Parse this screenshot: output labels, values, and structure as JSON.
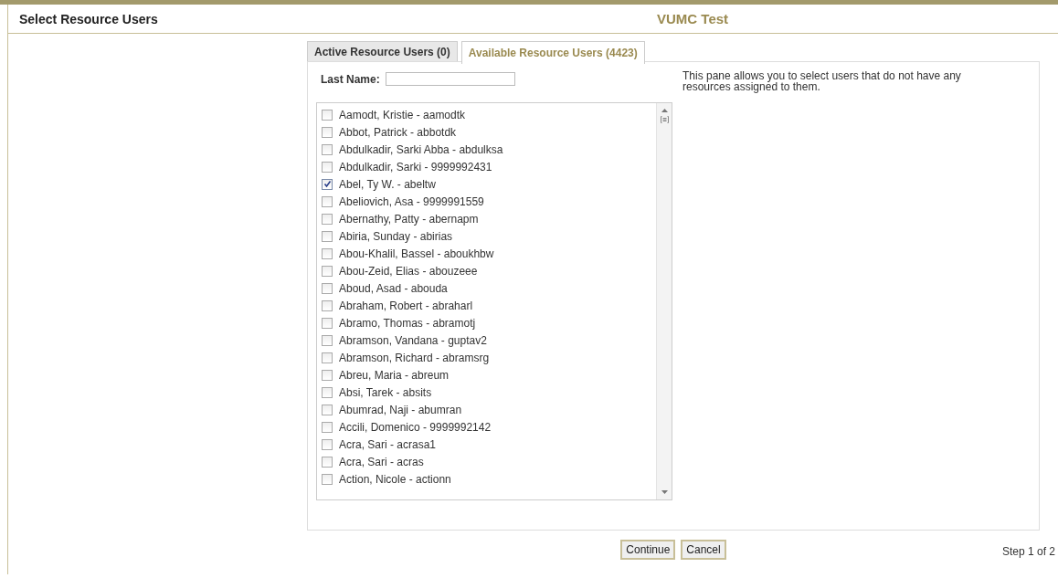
{
  "header": {
    "title": "Select Resource Users",
    "site": "VUMC Test"
  },
  "tabs": [
    {
      "label": "Active Resource Users (0)",
      "selected": false
    },
    {
      "label": "Available Resource Users (4423)",
      "selected": true
    }
  ],
  "filter": {
    "label": "Last Name:"
  },
  "description": "This pane allows you to select users that do not have any resources assigned to them.",
  "users": [
    {
      "label": "Aamodt, Kristie - aamodtk",
      "checked": false
    },
    {
      "label": "Abbot, Patrick - abbotdk",
      "checked": false
    },
    {
      "label": "Abdulkadir, Sarki Abba - abdulksa",
      "checked": false
    },
    {
      "label": "Abdulkadir, Sarki - 9999992431",
      "checked": false
    },
    {
      "label": "Abel, Ty W. - abeltw",
      "checked": true
    },
    {
      "label": "Abeliovich, Asa - 9999991559",
      "checked": false
    },
    {
      "label": "Abernathy, Patty - abernapm",
      "checked": false
    },
    {
      "label": "Abiria, Sunday - abirias",
      "checked": false
    },
    {
      "label": "Abou-Khalil, Bassel - aboukhbw",
      "checked": false
    },
    {
      "label": "Abou-Zeid, Elias - abouzeee",
      "checked": false
    },
    {
      "label": "Aboud, Asad - abouda",
      "checked": false
    },
    {
      "label": "Abraham, Robert - abraharl",
      "checked": false
    },
    {
      "label": "Abramo, Thomas - abramotj",
      "checked": false
    },
    {
      "label": "Abramson, Vandana - guptav2",
      "checked": false
    },
    {
      "label": "Abramson, Richard - abramsrg",
      "checked": false
    },
    {
      "label": "Abreu, Maria - abreum",
      "checked": false
    },
    {
      "label": "Absi, Tarek - absits",
      "checked": false
    },
    {
      "label": "Abumrad, Naji - abumran",
      "checked": false
    },
    {
      "label": "Accili, Domenico - 9999992142",
      "checked": false
    },
    {
      "label": "Acra, Sari - acrasa1",
      "checked": false
    },
    {
      "label": "Acra, Sari - acras",
      "checked": false
    },
    {
      "label": "Action, Nicole - actionn",
      "checked": false
    }
  ],
  "buttons": [
    "Continue",
    "Cancel"
  ],
  "step": "Step 1 of 2"
}
